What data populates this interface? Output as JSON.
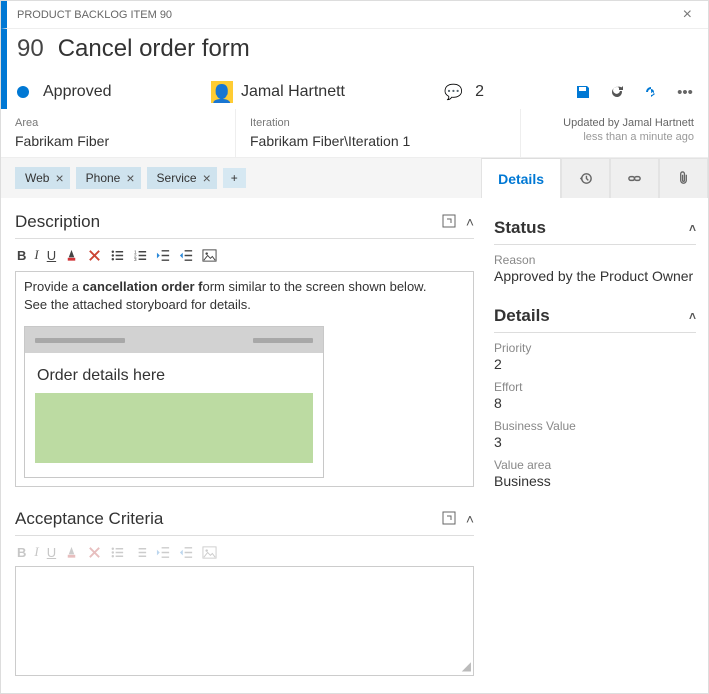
{
  "header": {
    "eyebrow": "PRODUCT BACKLOG ITEM 90"
  },
  "title": {
    "id": "90",
    "text": "Cancel order form"
  },
  "state": {
    "label": "Approved"
  },
  "assignee": {
    "name": "Jamal Hartnett"
  },
  "discussion": {
    "count": "2"
  },
  "area": {
    "label": "Area",
    "value": "Fabrikam Fiber"
  },
  "iteration": {
    "label": "Iteration",
    "value": "Fabrikam Fiber\\Iteration 1"
  },
  "updated": {
    "by": "Updated by Jamal Hartnett",
    "when": "less than a minute ago"
  },
  "tags": {
    "0": "Web",
    "1": "Phone",
    "2": "Service",
    "add": "+"
  },
  "tabs": {
    "details": "Details"
  },
  "description": {
    "heading": "Description",
    "line1a": "Provide a ",
    "line1b": "cancellation order f",
    "line1c": "orm similar to the screen shown below.",
    "line2": "See the attached storyboard for details.",
    "mock_title": "Order details here"
  },
  "acceptance": {
    "heading": "Acceptance Criteria"
  },
  "status_panel": {
    "heading": "Status",
    "reason_label": "Reason",
    "reason_value": "Approved by the Product Owner"
  },
  "details_panel": {
    "heading": "Details",
    "priority_label": "Priority",
    "priority_value": "2",
    "effort_label": "Effort",
    "effort_value": "8",
    "bv_label": "Business Value",
    "bv_value": "3",
    "va_label": "Value area",
    "va_value": "Business"
  }
}
